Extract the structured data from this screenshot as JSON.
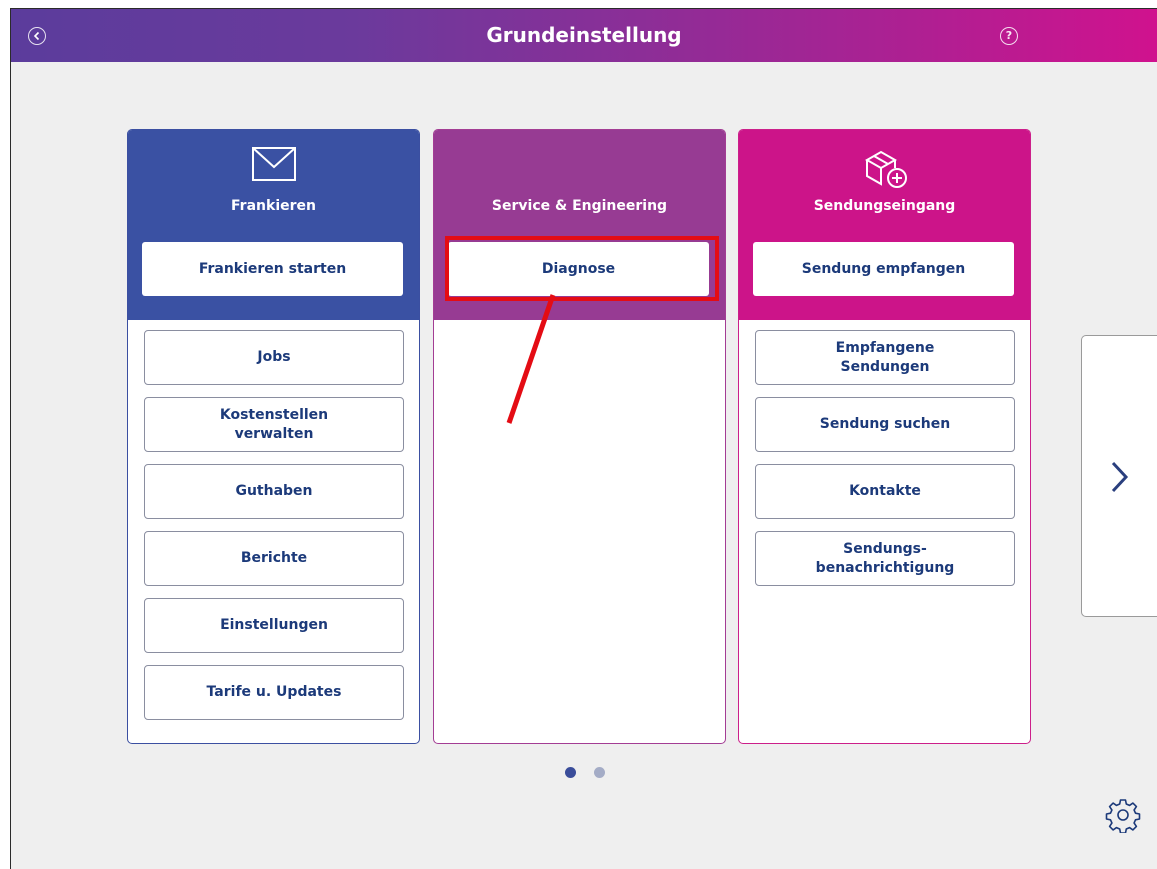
{
  "header": {
    "title": "Grundeinstellung",
    "back_icon": "chevron-left-circle-icon",
    "help_symbol": "?"
  },
  "tiles": [
    {
      "title": "Frankieren",
      "icon": "envelope-icon",
      "primary_button": "Frankieren starten",
      "items": [
        "Jobs",
        "Kostenstellen\nverwalten",
        "Guthaben",
        "Berichte",
        "Einstellungen",
        "Tarife u. Updates"
      ]
    },
    {
      "title": "Service & Engineering",
      "icon": "",
      "primary_button": "Diagnose",
      "items": []
    },
    {
      "title": "Sendungseingang",
      "icon": "package-add-icon",
      "primary_button": "Sendung empfangen",
      "items": [
        "Empfangene\nSendungen",
        "Sendung suchen",
        "Kontakte",
        "Sendungs-\nbenachrichtigung"
      ]
    }
  ],
  "pagination": {
    "pages": 2,
    "current": 1
  },
  "annotation": {
    "highlighted_button": "Diagnose",
    "color": "#e40c14"
  },
  "colors": {
    "frankieren": "#3a51a3",
    "service": "#973b93",
    "sendungseingang": "#cc1489",
    "text": "#1c3a7a"
  }
}
